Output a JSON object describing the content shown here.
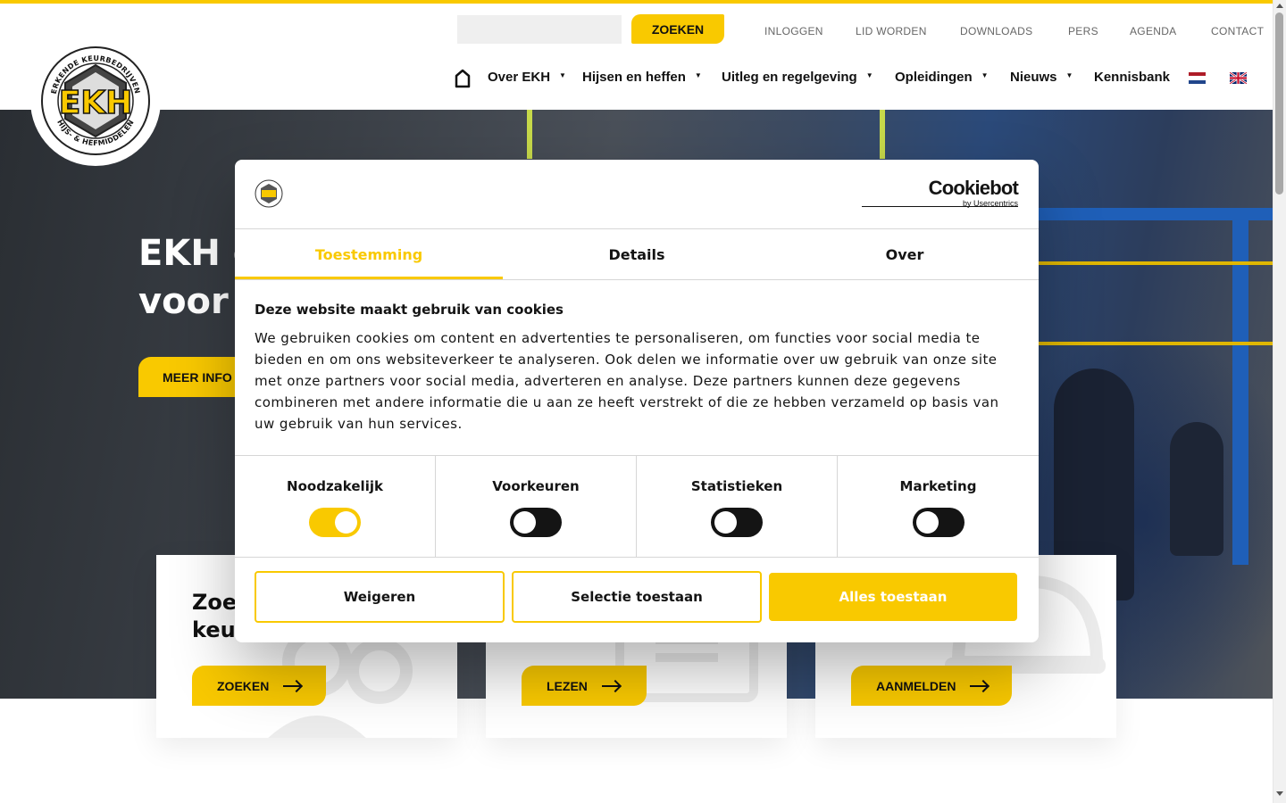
{
  "header": {
    "search_placeholder": "",
    "search_button": "ZOEKEN",
    "top_links": [
      "INLOGGEN",
      "LID WORDEN",
      "DOWNLOADS",
      "PERS",
      "AGENDA",
      "CONTACT"
    ],
    "nav": [
      {
        "label": "Over EKH",
        "has_dropdown": true
      },
      {
        "label": "Hijsen en heffen",
        "has_dropdown": true
      },
      {
        "label": "Uitleg en regelgeving",
        "has_dropdown": true
      },
      {
        "label": "Opleidingen",
        "has_dropdown": true
      },
      {
        "label": "Nieuws",
        "has_dropdown": true
      },
      {
        "label": "Kennisbank",
        "has_dropdown": false
      }
    ],
    "languages": [
      "nl-flag",
      "gb-flag"
    ]
  },
  "logo": {
    "brand": "EKH",
    "ring_top": "ERKENDE KEURBEDRIJVEN",
    "ring_bottom": "HIJS- & HEFMIDDELEN"
  },
  "hero": {
    "title_line1": "EKH g",
    "title_line2": "voor h",
    "cta": "MEER INFO"
  },
  "cards": [
    {
      "title_line1": "Zoek",
      "title_line2": "keur",
      "button": "ZOEKEN",
      "bg_icon": "people-icon"
    },
    {
      "title_line1": "",
      "title_line2": "",
      "button": "LEZEN",
      "bg_icon": "monitor-icon"
    },
    {
      "title_line1": "",
      "title_line2": "",
      "button": "AANMELDEN",
      "bg_icon": "helmet-icon"
    }
  ],
  "cookie_dialog": {
    "provider_name": "Cookiebot",
    "provider_sub": "by Usercentrics",
    "tabs": [
      "Toestemming",
      "Details",
      "Over"
    ],
    "active_tab": "Toestemming",
    "heading": "Deze website maakt gebruik van cookies",
    "body": "We gebruiken cookies om content en advertenties te personaliseren, om functies voor social media te bieden en om ons websiteverkeer te analyseren. Ook delen we informatie over uw gebruik van onze site met onze partners voor social media, adverteren en analyse. Deze partners kunnen deze gegevens combineren met andere informatie die u aan ze heeft verstrekt of die ze hebben verzameld op basis van uw gebruik van hun services.",
    "categories": [
      {
        "label": "Noodzakelijk",
        "enabled": true
      },
      {
        "label": "Voorkeuren",
        "enabled": false
      },
      {
        "label": "Statistieken",
        "enabled": false
      },
      {
        "label": "Marketing",
        "enabled": false
      }
    ],
    "buttons": {
      "reject": "Weigeren",
      "allow_selection": "Selectie toestaan",
      "allow_all": "Alles toestaan"
    }
  },
  "colors": {
    "accent": "#f9c900",
    "text": "#141414",
    "muted": "#666666"
  }
}
